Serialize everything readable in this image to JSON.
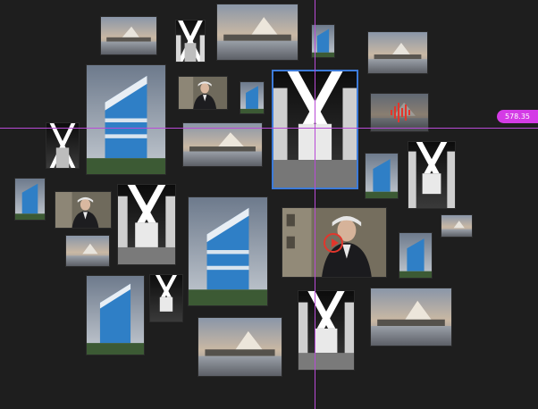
{
  "canvas": {
    "guide_color": "#b84ad6",
    "selection_color": "#3d7bd9",
    "ruler_readout": "578.35"
  },
  "thumbnails": [
    {
      "type": "museum-photo"
    },
    {
      "type": "x-corridor"
    },
    {
      "type": "museum-photo"
    },
    {
      "type": "building-photo"
    },
    {
      "type": "museum-photo"
    },
    {
      "type": "building-photo"
    },
    {
      "type": "portrait-photo"
    },
    {
      "type": "building-photo"
    },
    {
      "type": "x-corridor",
      "selected": true
    },
    {
      "type": "audio-clip"
    },
    {
      "type": "x-corridor"
    },
    {
      "type": "museum-photo"
    },
    {
      "type": "building-photo"
    },
    {
      "type": "x-corridor"
    },
    {
      "type": "building-photo"
    },
    {
      "type": "portrait-photo"
    },
    {
      "type": "x-corridor"
    },
    {
      "type": "building-photo"
    },
    {
      "type": "video-clip"
    },
    {
      "type": "museum-photo"
    },
    {
      "type": "museum-photo"
    },
    {
      "type": "building-photo"
    },
    {
      "type": "building-photo"
    },
    {
      "type": "x-corridor"
    },
    {
      "type": "museum-photo"
    },
    {
      "type": "x-corridor"
    },
    {
      "type": "museum-photo"
    }
  ]
}
